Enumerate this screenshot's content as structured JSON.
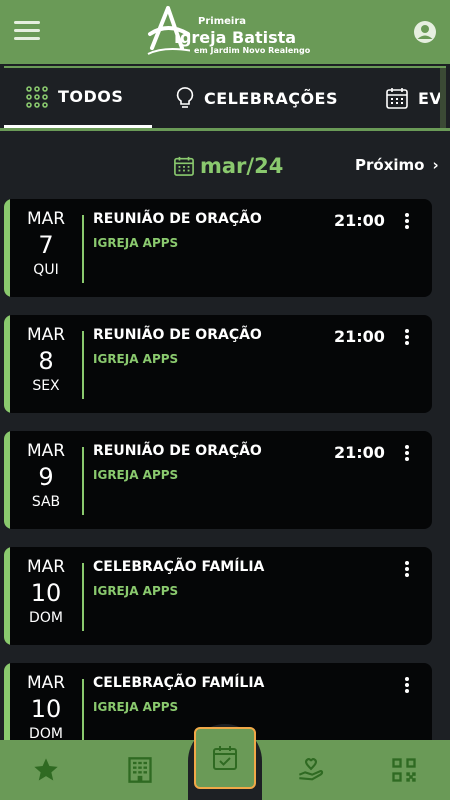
{
  "header": {
    "logo_line1": "Primeira",
    "logo_line2": "Igreja Batista",
    "logo_line3": "em Jardim Novo Realengo"
  },
  "tabs": [
    {
      "label": "TODOS",
      "icon": "grid-dots-icon",
      "active": true
    },
    {
      "label": "CELEBRAÇÕES",
      "icon": "lightbulb-icon",
      "active": false
    },
    {
      "label": "EVE",
      "icon": "calendar-icon",
      "active": false
    }
  ],
  "month": {
    "label": "mar/24",
    "next_label": "Próximo",
    "next_icon": "›"
  },
  "events": [
    {
      "month": "MAR",
      "day": "7",
      "weekday": "QUI",
      "title": "REUNIÃO DE ORAÇÃO",
      "org": "IGREJA APPS",
      "time": "21:00"
    },
    {
      "month": "MAR",
      "day": "8",
      "weekday": "SEX",
      "title": "REUNIÃO DE ORAÇÃO",
      "org": "IGREJA APPS",
      "time": "21:00"
    },
    {
      "month": "MAR",
      "day": "9",
      "weekday": "SAB",
      "title": "REUNIÃO DE ORAÇÃO",
      "org": "IGREJA APPS",
      "time": "21:00"
    },
    {
      "month": "MAR",
      "day": "10",
      "weekday": "DOM",
      "title": "CELEBRAÇÃO FAMÍLIA",
      "org": "IGREJA APPS",
      "time": ""
    },
    {
      "month": "MAR",
      "day": "10",
      "weekday": "DOM",
      "title": "CELEBRAÇÃO FAMÍLIA",
      "org": "IGREJA APPS",
      "time": ""
    }
  ],
  "bottom_nav": [
    {
      "icon": "star-icon"
    },
    {
      "icon": "building-icon"
    },
    {
      "icon": "calendar-check-icon",
      "active": true
    },
    {
      "icon": "heart-hand-icon"
    },
    {
      "icon": "qr-code-icon"
    }
  ],
  "colors": {
    "primary_green": "#6a9a57",
    "accent_green": "#8ac96e",
    "background": "#1d2024",
    "card": "#050607",
    "active_outline": "#f0a848"
  }
}
